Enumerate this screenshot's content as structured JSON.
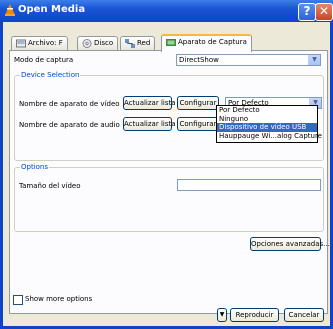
{
  "window": {
    "title": "Open Media",
    "help_glyph": "?",
    "close_glyph": "✕"
  },
  "tabs": [
    {
      "label": "Archivo: F",
      "icon": "file-icon"
    },
    {
      "label": "Disco",
      "icon": "disc-icon"
    },
    {
      "label": "Red",
      "icon": "network-icon"
    },
    {
      "label": "Aparato de Captura",
      "icon": "capture-device-icon"
    }
  ],
  "capture": {
    "mode_label": "Modo de captura",
    "mode_value": "DirectShow"
  },
  "device_selection": {
    "title": "Device Selection",
    "video_label": "Nombre de aparato de vídeo",
    "audio_label": "Nombre de aparato de audio",
    "refresh_label": "Actualizar lista",
    "configure_label": "Configurar",
    "video_value": "Por Defecto",
    "dropdown_options": [
      "Por Defecto",
      "Ninguno",
      "Dispositivo de vídeo USB",
      "Hauppauge Wi...alog Capture"
    ],
    "dropdown_selected_index": 2
  },
  "options": {
    "title": "Options",
    "video_size_label": "Tamaño del vídeo",
    "video_size_value": "",
    "advanced_label": "Opciones avanzadas..."
  },
  "footer": {
    "show_more_label": "Show more options",
    "play_label": "Reproducir",
    "cancel_label": "Cancelar"
  },
  "colors": {
    "titlebar": "#0f44c8",
    "group_title": "#0046d5",
    "selection": "#316ac5",
    "desktop": "#0a6a2a"
  }
}
